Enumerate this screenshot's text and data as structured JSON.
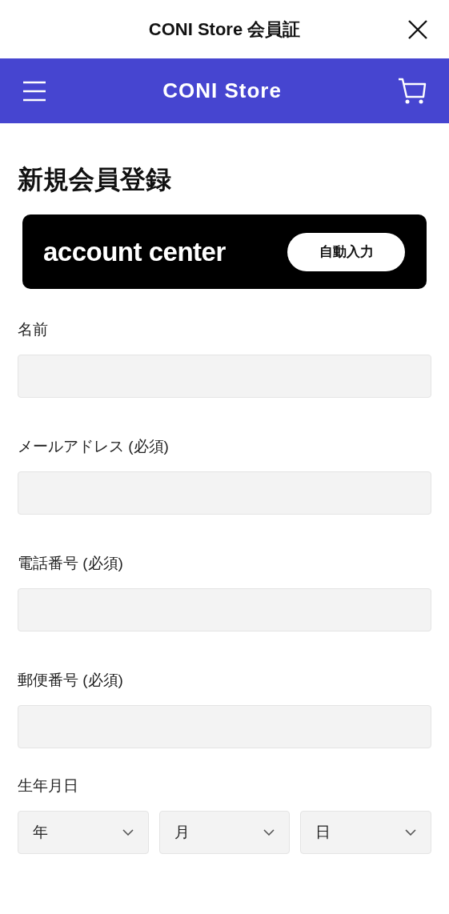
{
  "window": {
    "title": "CONI Store 会員証"
  },
  "header": {
    "brand": "CONI Store"
  },
  "page": {
    "heading": "新規会員登録"
  },
  "account_center": {
    "logo": "account center",
    "button": "自動入力"
  },
  "fields": [
    {
      "label": "名前"
    },
    {
      "label": "メールアドレス (必須)"
    },
    {
      "label": "電話番号 (必須)"
    },
    {
      "label": "郵便番号 (必須)"
    }
  ],
  "birthday": {
    "label": "生年月日",
    "selects": [
      "年",
      "月",
      "日"
    ]
  }
}
